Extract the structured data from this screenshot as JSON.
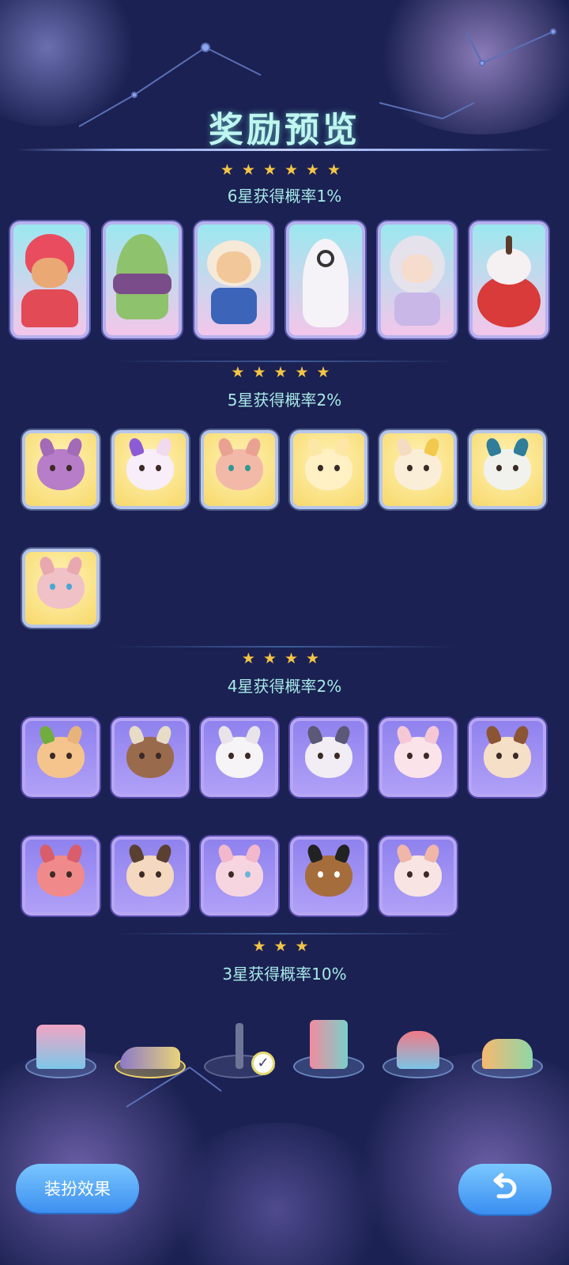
{
  "title": "奖励预览",
  "tiers": [
    {
      "stars": "★★★★★★",
      "label": "6星获得概率1%"
    },
    {
      "stars": "★★★★★",
      "label": "5星获得概率2%"
    },
    {
      "stars": "★★★★",
      "label": "4星获得概率2%"
    },
    {
      "stars": "★★★",
      "label": "3星获得概率10%"
    }
  ],
  "six_star_items": [
    "red-hooded-bunny-cat",
    "green-cloak-with-scarf",
    "blonde-boy-in-white-cloak",
    "white-ghost-with-swirl-eye",
    "silver-haired-girl",
    "white-cat-on-red-apple"
  ],
  "five_star_items": [
    "purple-triceratops-head",
    "unicorn-head",
    "pink-lynx-head",
    "yellow-duck-head",
    "bunny-with-party-hat",
    "blue-dog-head",
    "pink-bird-dragon-head"
  ],
  "four_star_items": [
    "deer-with-green-hat",
    "brown-cow-head",
    "white-sheep-head",
    "goggles-cat-head",
    "pink-mouse-head",
    "brown-lop-bunny-head",
    "pink-fox-head",
    "antler-hat-head",
    "pink-bunny-with-mask",
    "owl-with-top-hat",
    "pink-clown-bunny-head"
  ],
  "three_star_items": [
    "candy-shop",
    "golden-sneaker",
    "lamp-tower",
    "wardrobe-cabinet",
    "strawberry-house",
    "slide-playset"
  ],
  "selected_three_star": "lamp-tower",
  "buttons": {
    "dress_effect": "装扮效果",
    "back_icon": "return-arrow-icon"
  },
  "colors": {
    "background": "#1b2152",
    "title": "#bff6ef",
    "star": "#f3c546",
    "tier_text": "#a7e9e7",
    "button": "#4a9cf2"
  }
}
